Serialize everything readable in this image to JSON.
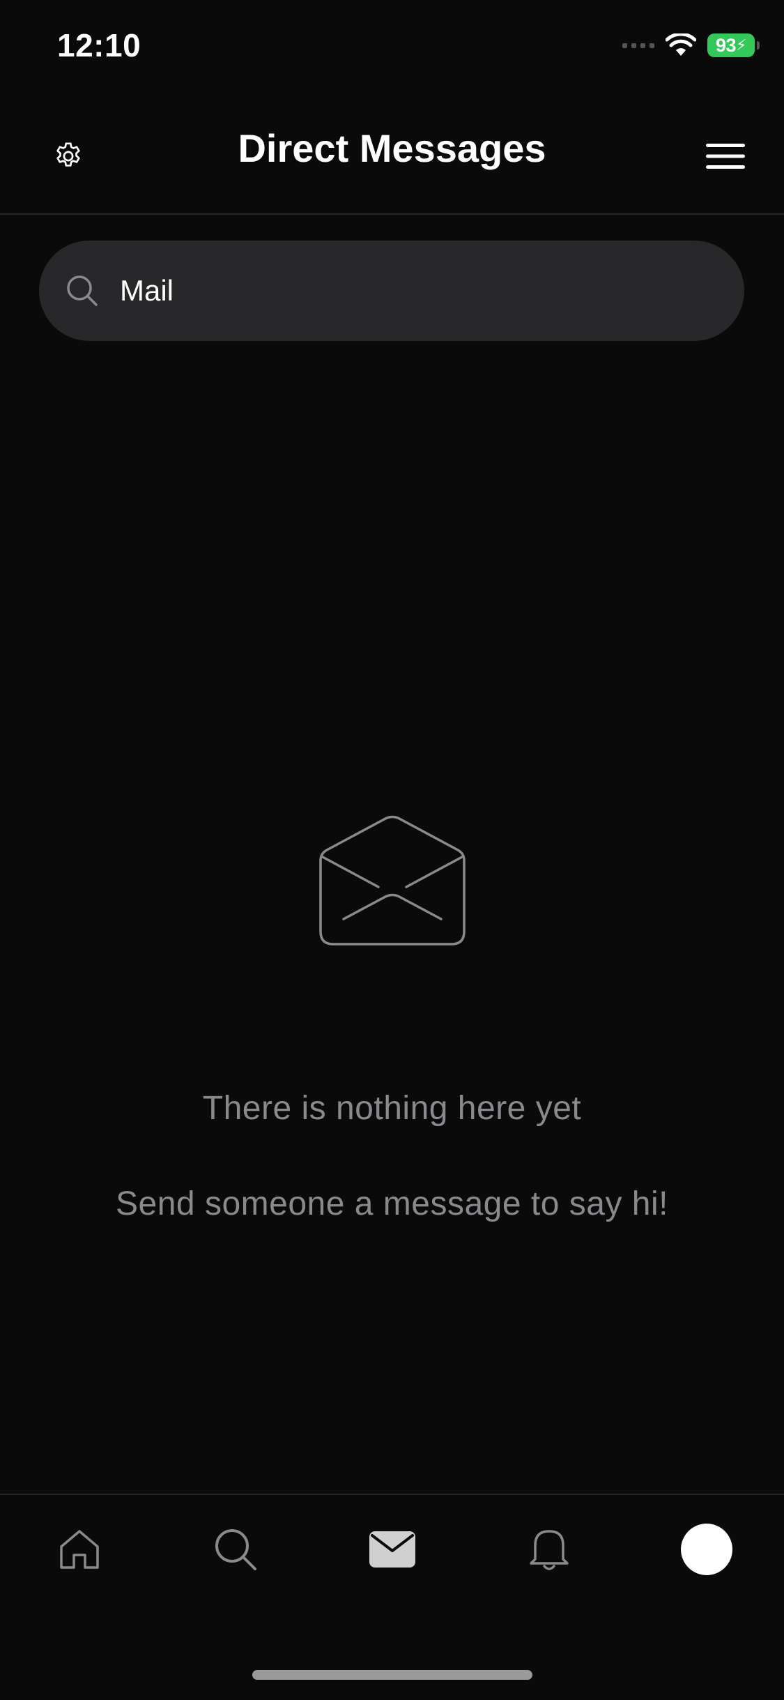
{
  "status_bar": {
    "time": "12:10",
    "battery": "93"
  },
  "header": {
    "title": "Direct Messages"
  },
  "search": {
    "value": "Mail"
  },
  "empty_state": {
    "title": "There is nothing here yet",
    "subtitle": "Send someone a message to say hi!"
  },
  "tab_bar": {
    "items": [
      {
        "icon": "home-icon"
      },
      {
        "icon": "search-icon"
      },
      {
        "icon": "mail-icon",
        "active": true
      },
      {
        "icon": "bell-icon"
      },
      {
        "icon": "avatar"
      }
    ]
  },
  "colors": {
    "background": "#0a0a0a",
    "search_field": "#28282a",
    "muted_text": "#8a8a8e",
    "battery": "#34c759"
  }
}
